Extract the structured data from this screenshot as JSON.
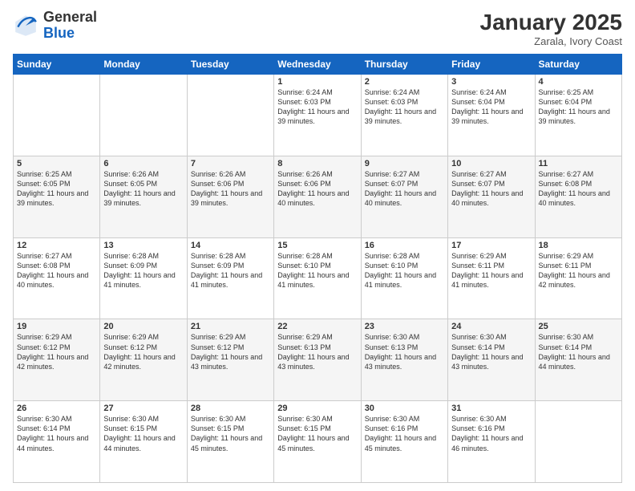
{
  "logo": {
    "general": "General",
    "blue": "Blue"
  },
  "title": "January 2025",
  "subtitle": "Zarala, Ivory Coast",
  "days_header": [
    "Sunday",
    "Monday",
    "Tuesday",
    "Wednesday",
    "Thursday",
    "Friday",
    "Saturday"
  ],
  "weeks": [
    [
      {
        "day": "",
        "info": ""
      },
      {
        "day": "",
        "info": ""
      },
      {
        "day": "",
        "info": ""
      },
      {
        "day": "1",
        "info": "Sunrise: 6:24 AM\nSunset: 6:03 PM\nDaylight: 11 hours and 39 minutes."
      },
      {
        "day": "2",
        "info": "Sunrise: 6:24 AM\nSunset: 6:03 PM\nDaylight: 11 hours and 39 minutes."
      },
      {
        "day": "3",
        "info": "Sunrise: 6:24 AM\nSunset: 6:04 PM\nDaylight: 11 hours and 39 minutes."
      },
      {
        "day": "4",
        "info": "Sunrise: 6:25 AM\nSunset: 6:04 PM\nDaylight: 11 hours and 39 minutes."
      }
    ],
    [
      {
        "day": "5",
        "info": "Sunrise: 6:25 AM\nSunset: 6:05 PM\nDaylight: 11 hours and 39 minutes."
      },
      {
        "day": "6",
        "info": "Sunrise: 6:26 AM\nSunset: 6:05 PM\nDaylight: 11 hours and 39 minutes."
      },
      {
        "day": "7",
        "info": "Sunrise: 6:26 AM\nSunset: 6:06 PM\nDaylight: 11 hours and 39 minutes."
      },
      {
        "day": "8",
        "info": "Sunrise: 6:26 AM\nSunset: 6:06 PM\nDaylight: 11 hours and 40 minutes."
      },
      {
        "day": "9",
        "info": "Sunrise: 6:27 AM\nSunset: 6:07 PM\nDaylight: 11 hours and 40 minutes."
      },
      {
        "day": "10",
        "info": "Sunrise: 6:27 AM\nSunset: 6:07 PM\nDaylight: 11 hours and 40 minutes."
      },
      {
        "day": "11",
        "info": "Sunrise: 6:27 AM\nSunset: 6:08 PM\nDaylight: 11 hours and 40 minutes."
      }
    ],
    [
      {
        "day": "12",
        "info": "Sunrise: 6:27 AM\nSunset: 6:08 PM\nDaylight: 11 hours and 40 minutes."
      },
      {
        "day": "13",
        "info": "Sunrise: 6:28 AM\nSunset: 6:09 PM\nDaylight: 11 hours and 41 minutes."
      },
      {
        "day": "14",
        "info": "Sunrise: 6:28 AM\nSunset: 6:09 PM\nDaylight: 11 hours and 41 minutes."
      },
      {
        "day": "15",
        "info": "Sunrise: 6:28 AM\nSunset: 6:10 PM\nDaylight: 11 hours and 41 minutes."
      },
      {
        "day": "16",
        "info": "Sunrise: 6:28 AM\nSunset: 6:10 PM\nDaylight: 11 hours and 41 minutes."
      },
      {
        "day": "17",
        "info": "Sunrise: 6:29 AM\nSunset: 6:11 PM\nDaylight: 11 hours and 41 minutes."
      },
      {
        "day": "18",
        "info": "Sunrise: 6:29 AM\nSunset: 6:11 PM\nDaylight: 11 hours and 42 minutes."
      }
    ],
    [
      {
        "day": "19",
        "info": "Sunrise: 6:29 AM\nSunset: 6:12 PM\nDaylight: 11 hours and 42 minutes."
      },
      {
        "day": "20",
        "info": "Sunrise: 6:29 AM\nSunset: 6:12 PM\nDaylight: 11 hours and 42 minutes."
      },
      {
        "day": "21",
        "info": "Sunrise: 6:29 AM\nSunset: 6:12 PM\nDaylight: 11 hours and 43 minutes."
      },
      {
        "day": "22",
        "info": "Sunrise: 6:29 AM\nSunset: 6:13 PM\nDaylight: 11 hours and 43 minutes."
      },
      {
        "day": "23",
        "info": "Sunrise: 6:30 AM\nSunset: 6:13 PM\nDaylight: 11 hours and 43 minutes."
      },
      {
        "day": "24",
        "info": "Sunrise: 6:30 AM\nSunset: 6:14 PM\nDaylight: 11 hours and 43 minutes."
      },
      {
        "day": "25",
        "info": "Sunrise: 6:30 AM\nSunset: 6:14 PM\nDaylight: 11 hours and 44 minutes."
      }
    ],
    [
      {
        "day": "26",
        "info": "Sunrise: 6:30 AM\nSunset: 6:14 PM\nDaylight: 11 hours and 44 minutes."
      },
      {
        "day": "27",
        "info": "Sunrise: 6:30 AM\nSunset: 6:15 PM\nDaylight: 11 hours and 44 minutes."
      },
      {
        "day": "28",
        "info": "Sunrise: 6:30 AM\nSunset: 6:15 PM\nDaylight: 11 hours and 45 minutes."
      },
      {
        "day": "29",
        "info": "Sunrise: 6:30 AM\nSunset: 6:15 PM\nDaylight: 11 hours and 45 minutes."
      },
      {
        "day": "30",
        "info": "Sunrise: 6:30 AM\nSunset: 6:16 PM\nDaylight: 11 hours and 45 minutes."
      },
      {
        "day": "31",
        "info": "Sunrise: 6:30 AM\nSunset: 6:16 PM\nDaylight: 11 hours and 46 minutes."
      },
      {
        "day": "",
        "info": ""
      }
    ]
  ]
}
